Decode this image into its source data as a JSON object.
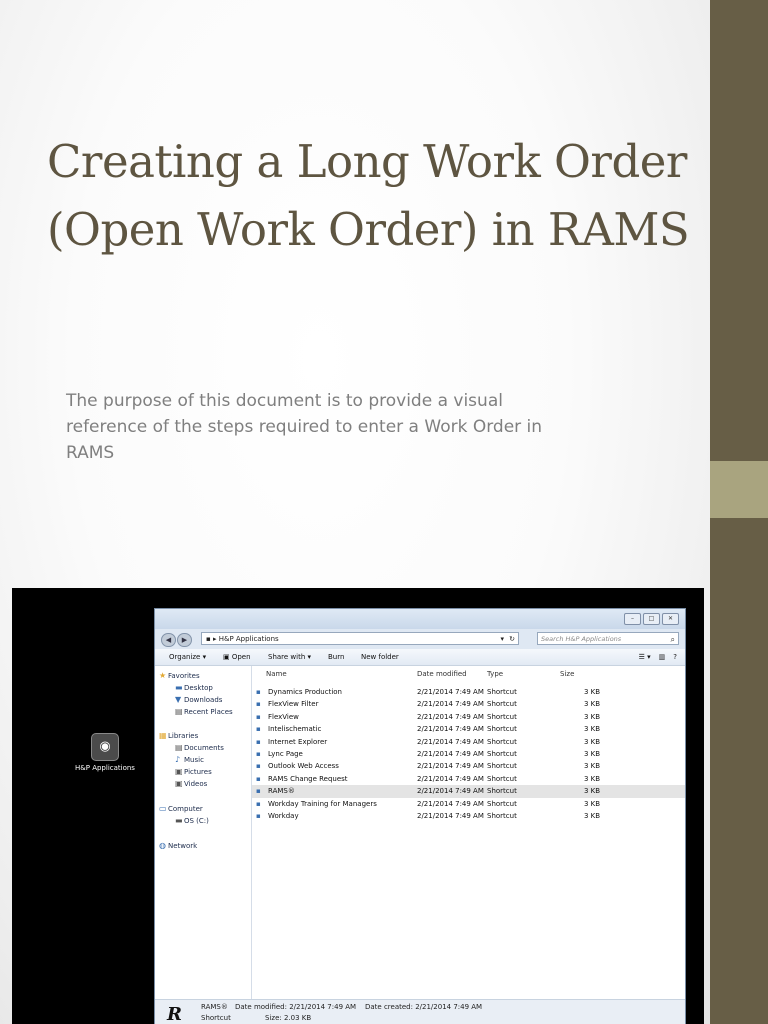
{
  "slide": {
    "title": "Creating a Long Work Order (Open Work Order) in RAMS",
    "subtitle": "The purpose of this document is to provide a visual reference of the steps required to enter a Work Order in RAMS",
    "colors": {
      "title": "#5e5541",
      "sidebar": "#675e46",
      "accent": "#a9a47f",
      "subtitle": "#7f7f7f"
    }
  },
  "desktop": {
    "icon_name": "hp-applications-icon",
    "icon_label": "H&P Applications"
  },
  "explorer": {
    "address": "H&P Applications",
    "search_placeholder": "Search H&P Applications",
    "toolbar": {
      "organize": "Organize ▾",
      "open": "Open",
      "share_with": "Share with ▾",
      "burn": "Burn",
      "new_folder": "New folder"
    },
    "nav": {
      "favorites": "Favorites",
      "desktop": "Desktop",
      "downloads": "Downloads",
      "recent_places": "Recent Places",
      "libraries": "Libraries",
      "documents": "Documents",
      "music": "Music",
      "pictures": "Pictures",
      "videos": "Videos",
      "computer": "Computer",
      "os_c": "OS (C:)",
      "network": "Network"
    },
    "columns": {
      "name": "Name",
      "date": "Date modified",
      "type": "Type",
      "size": "Size"
    },
    "files": [
      {
        "name": "Dynamics Production",
        "date": "2/21/2014 7:49 AM",
        "type": "Shortcut",
        "size": "3 KB"
      },
      {
        "name": "FlexView Filter",
        "date": "2/21/2014 7:49 AM",
        "type": "Shortcut",
        "size": "3 KB"
      },
      {
        "name": "FlexView",
        "date": "2/21/2014 7:49 AM",
        "type": "Shortcut",
        "size": "3 KB"
      },
      {
        "name": "Intelischematic",
        "date": "2/21/2014 7:49 AM",
        "type": "Shortcut",
        "size": "3 KB"
      },
      {
        "name": "Internet Explorer",
        "date": "2/21/2014 7:49 AM",
        "type": "Shortcut",
        "size": "3 KB"
      },
      {
        "name": "Lync Page",
        "date": "2/21/2014 7:49 AM",
        "type": "Shortcut",
        "size": "3 KB"
      },
      {
        "name": "Outlook Web Access",
        "date": "2/21/2014 7:49 AM",
        "type": "Shortcut",
        "size": "3 KB"
      },
      {
        "name": "RAMS Change Request",
        "date": "2/21/2014 7:49 AM",
        "type": "Shortcut",
        "size": "3 KB"
      },
      {
        "name": "RAMS®",
        "date": "2/21/2014 7:49 AM",
        "type": "Shortcut",
        "size": "3 KB"
      },
      {
        "name": "Workday Training for Managers",
        "date": "2/21/2014 7:49 AM",
        "type": "Shortcut",
        "size": "3 KB"
      },
      {
        "name": "Workday",
        "date": "2/21/2014 7:49 AM",
        "type": "Shortcut",
        "size": "3 KB"
      }
    ],
    "selected_file": "RAMS®",
    "details": {
      "name": "RAMS®",
      "date_modified": "Date modified: 2/21/2014 7:49 AM",
      "date_created": "Date created: 2/21/2014 7:49 AM",
      "type": "Shortcut",
      "size": "Size: 2.03 KB"
    }
  }
}
